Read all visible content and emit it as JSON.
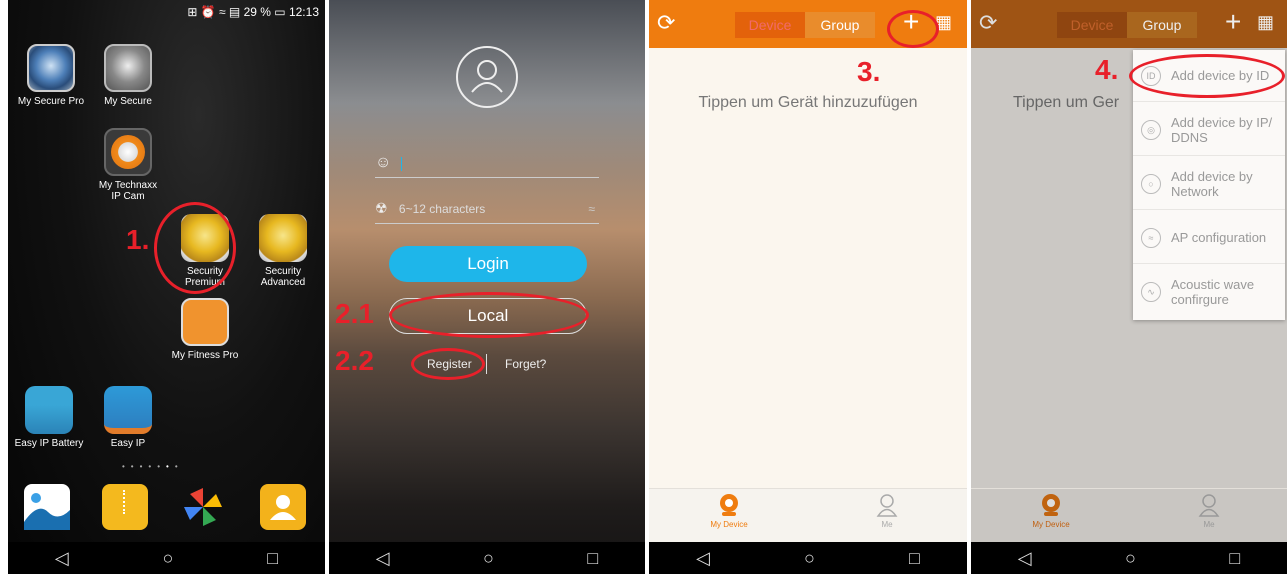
{
  "panel1": {
    "status": "⊞ ⏰ ≈ ▤ 29 % ▭ 12:13",
    "apps": {
      "my_secure_pro": "My Secure Pro",
      "my_secure": "My Secure",
      "my_technaxx_ip_cam": "My Technaxx IP Cam",
      "security_premium": "Security Premium",
      "security_advanced": "Security Advanced",
      "my_fitness_pro": "My Fitness Pro",
      "easy_ip_battery": "Easy IP Battery",
      "easy_ip": "Easy IP"
    },
    "annotation": "1."
  },
  "panel2": {
    "password_placeholder": "6~12 characters",
    "login_label": "Login",
    "local_label": "Local",
    "register_label": "Register",
    "forget_label": "Forget?",
    "annotation_local": "2.1",
    "annotation_register": "2.2"
  },
  "panel3": {
    "tab_device": "Device",
    "tab_group": "Group",
    "hint": "Tippen um Gerät hinzuzufügen",
    "bottom_my_device": "My Device",
    "bottom_me": "Me",
    "annotation": "3."
  },
  "panel4": {
    "tab_device": "Device",
    "tab_group": "Group",
    "hint": "Tippen um Ger",
    "bottom_my_device": "My Device",
    "bottom_me": "Me",
    "annotation": "4.",
    "menu": [
      {
        "label": "Add device by ID",
        "icon": "ID"
      },
      {
        "label": "Add device by IP/ DDNS",
        "icon": "globe"
      },
      {
        "label": "Add device by Network",
        "icon": "network"
      },
      {
        "label": "AP configuration",
        "icon": "wifi"
      },
      {
        "label": "Acoustic wave confirgure",
        "icon": "wave"
      }
    ]
  },
  "colors": {
    "accent": "#ef7c0f",
    "annotation": "#e8202a",
    "login": "#1eb6ea"
  }
}
